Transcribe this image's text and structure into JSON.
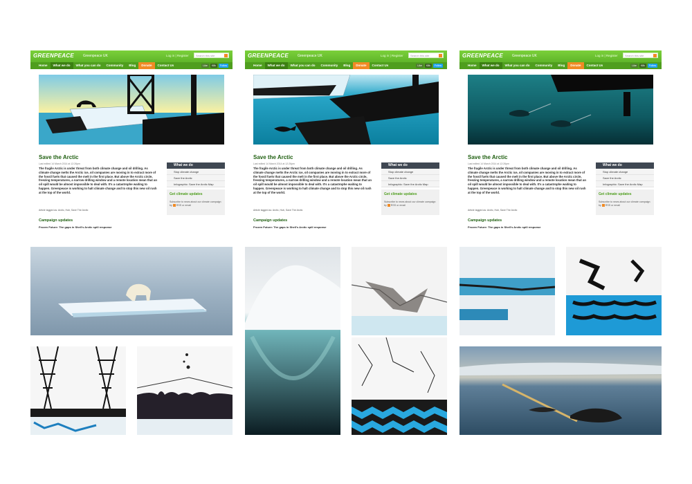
{
  "site": {
    "logo": "GREENPEACE",
    "country": "Greenpeace UK",
    "login": "Log in | Register",
    "search_placeholder": "Search this site",
    "nav": [
      "Home",
      "What we do",
      "What you can do",
      "Community",
      "Blog",
      "Donate",
      "Contact Us"
    ],
    "social": {
      "like": "Like",
      "count": "K8k",
      "follow": "Follow"
    }
  },
  "article": {
    "title": "Save the Arctic",
    "edited": "Last edited 14 March 2014 at 12:26pm",
    "body": "The fragile Arctic is under threat from both climate change and oil drilling. As climate change melts the Arctic ice, oil companies are moving in to extract more of the fossil fuels that caused the melt in the first place. But above the Arctic circle, freezing temperatures, a narrow drilling window and a remote location mean that an oil spill would be almost impossible to deal with. It's a catastrophe waiting to happen. Greenpeace is working to halt climate change and to stop this new oil rush at the top of the world.",
    "tags": "Article tagged as:  Arctic,  Hub,  Save The Arctic",
    "campaign_updates": "Campaign updates",
    "frozen": "Frozen Future: The gaps in Shell's Arctic spill response"
  },
  "sidebar": {
    "heading": "What we do",
    "items": [
      "Stop climate change",
      "Save the Arctic",
      "Infographic: Save the Arctic Map"
    ],
    "updates_title": "Get climate updates",
    "updates_text": "Subscribe to news about our climate campaign by",
    "updates_suffix": "RSS or email"
  },
  "colors": {
    "brand_green": "#6bbf30",
    "nav_green": "#4f9e1e",
    "donate_orange": "#f08a24",
    "sidebar_dark": "#3f4752"
  }
}
